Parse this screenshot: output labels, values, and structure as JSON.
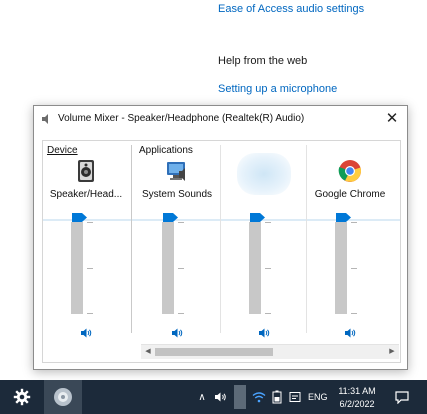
{
  "settings_page": {
    "ease_link": "Ease of Access audio settings",
    "help_heading": "Help from the web",
    "mic_link": "Setting up a microphone"
  },
  "mixer": {
    "title": "Volume Mixer - Speaker/Headphone (Realtek(R) Audio)",
    "close_glyph": "✕",
    "device_label": "Device",
    "applications_label": "Applications",
    "device": {
      "name": "Speaker/Head...",
      "icon": "speaker-device-icon",
      "volume_percent": 100
    },
    "apps": [
      {
        "name": "System Sounds",
        "icon": "system-sounds-icon",
        "volume_percent": 100
      },
      {
        "name": "",
        "icon": "blurred-app-icon",
        "volume_percent": 100
      },
      {
        "name": "Google Chrome",
        "icon": "chrome-icon",
        "volume_percent": 100
      }
    ],
    "scrollbar": {
      "left_glyph": "◀",
      "right_glyph": "▶"
    }
  },
  "taskbar": {
    "language": "ENG",
    "chevron_glyph": "∧",
    "time": "11:31 AM",
    "date": "6/2/2022",
    "icons": [
      "gear-icon",
      "app-icon",
      "chevron-up-icon",
      "volume-icon",
      "app-indicator-icon",
      "wifi-icon",
      "battery-icon",
      "tablet-icon",
      "notification-icon"
    ]
  },
  "colors": {
    "link": "#0067c0",
    "accent": "#0078d7",
    "taskbar": "#1c2a3a"
  }
}
